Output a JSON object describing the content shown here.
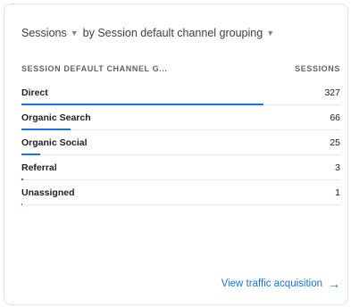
{
  "card": {
    "title": {
      "metric": "Sessions",
      "dimension": "by Session default channel grouping"
    },
    "table": {
      "header": {
        "dimension": "SESSION DEFAULT CHANNEL G...",
        "metric": "SESSIONS"
      },
      "rows": [
        {
          "label": "Direct",
          "value": "327"
        },
        {
          "label": "Organic Search",
          "value": "66"
        },
        {
          "label": "Organic Social",
          "value": "25"
        },
        {
          "label": "Referral",
          "value": "3"
        },
        {
          "label": "Unassigned",
          "value": "1"
        }
      ]
    },
    "footer_link": {
      "label": "View traffic acquisition"
    }
  },
  "colors": {
    "accent": "#1a73e8",
    "text": "#202124",
    "muted": "#5f6368",
    "divider": "#e8eaed"
  },
  "icons": [
    "dropdown-caret-icon",
    "dropdown-caret-icon",
    "arrow-right-icon"
  ]
}
